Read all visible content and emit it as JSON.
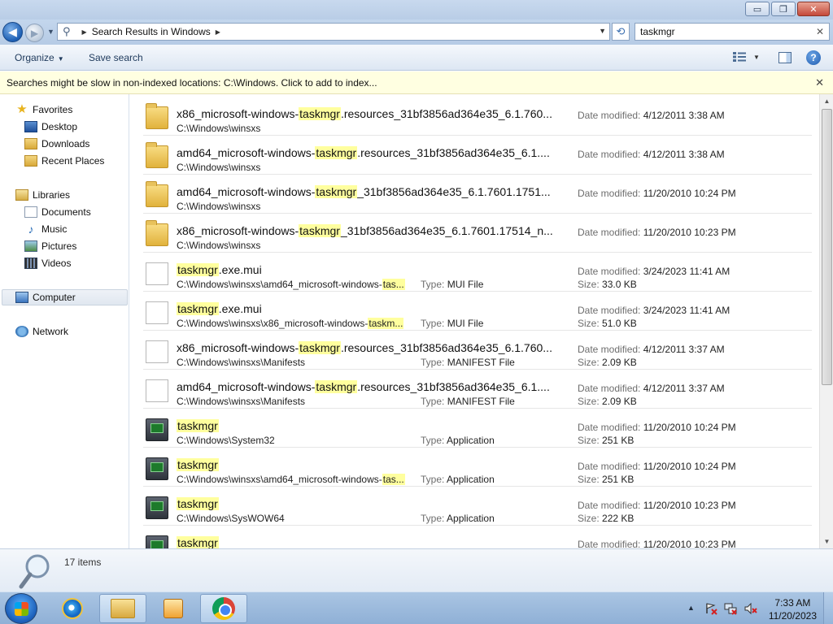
{
  "window": {
    "controls": {
      "minimize": "▭",
      "maximize": "❐",
      "close": "✕"
    }
  },
  "address_bar": {
    "breadcrumb": "Search Results in Windows",
    "search_value": "taskmgr"
  },
  "command_bar": {
    "organize": "Organize",
    "save_search": "Save search"
  },
  "info_bar": {
    "message": "Searches might be slow in non-indexed locations: C:\\Windows. Click to add to index..."
  },
  "nav_pane": {
    "favorites": "Favorites",
    "favorites_items": [
      "Desktop",
      "Downloads",
      "Recent Places"
    ],
    "libraries": "Libraries",
    "libraries_items": [
      "Documents",
      "Music",
      "Pictures",
      "Videos"
    ],
    "computer": "Computer",
    "network": "Network"
  },
  "labels": {
    "date_modified": "Date modified:",
    "size": "Size:",
    "type": "Type:"
  },
  "results": [
    {
      "icon": "folder-icon",
      "pre": "x86_microsoft-windows-",
      "hl": "taskmgr",
      "post": ".resources_31bf3856ad364e35_6.1.760...",
      "path_pre": "C:\\Windows\\winsxs",
      "path_hl": "",
      "path_post": "",
      "type": "",
      "modified": "4/12/2011 3:38 AM",
      "size": ""
    },
    {
      "icon": "folder-icon",
      "pre": "amd64_microsoft-windows-",
      "hl": "taskmgr",
      "post": ".resources_31bf3856ad364e35_6.1....",
      "path_pre": "C:\\Windows\\winsxs",
      "path_hl": "",
      "path_post": "",
      "type": "",
      "modified": "4/12/2011 3:38 AM",
      "size": ""
    },
    {
      "icon": "folder-icon",
      "pre": "amd64_microsoft-windows-",
      "hl": "taskmgr",
      "post": "_31bf3856ad364e35_6.1.7601.1751...",
      "path_pre": "C:\\Windows\\winsxs",
      "path_hl": "",
      "path_post": "",
      "type": "",
      "modified": "11/20/2010 10:24 PM",
      "size": ""
    },
    {
      "icon": "folder-icon",
      "pre": "x86_microsoft-windows-",
      "hl": "taskmgr",
      "post": "_31bf3856ad364e35_6.1.7601.17514_n...",
      "path_pre": "C:\\Windows\\winsxs",
      "path_hl": "",
      "path_post": "",
      "type": "",
      "modified": "11/20/2010 10:23 PM",
      "size": ""
    },
    {
      "icon": "file-icon",
      "pre": "",
      "hl": "taskmgr",
      "post": ".exe.mui",
      "path_pre": "C:\\Windows\\winsxs\\amd64_microsoft-windows-",
      "path_hl": "tas...",
      "path_post": "",
      "type": "MUI File",
      "modified": "3/24/2023 11:41 AM",
      "size": "33.0 KB"
    },
    {
      "icon": "file-icon",
      "pre": "",
      "hl": "taskmgr",
      "post": ".exe.mui",
      "path_pre": "C:\\Windows\\winsxs\\x86_microsoft-windows-",
      "path_hl": "taskm...",
      "path_post": "",
      "type": "MUI File",
      "modified": "3/24/2023 11:41 AM",
      "size": "51.0 KB"
    },
    {
      "icon": "file-icon",
      "pre": "x86_microsoft-windows-",
      "hl": "taskmgr",
      "post": ".resources_31bf3856ad364e35_6.1.760...",
      "path_pre": "C:\\Windows\\winsxs\\Manifests",
      "path_hl": "",
      "path_post": "",
      "type": "MANIFEST File",
      "modified": "4/12/2011 3:37 AM",
      "size": "2.09 KB"
    },
    {
      "icon": "file-icon",
      "pre": "amd64_microsoft-windows-",
      "hl": "taskmgr",
      "post": ".resources_31bf3856ad364e35_6.1....",
      "path_pre": "C:\\Windows\\winsxs\\Manifests",
      "path_hl": "",
      "path_post": "",
      "type": "MANIFEST File",
      "modified": "4/12/2011 3:37 AM",
      "size": "2.09 KB"
    },
    {
      "icon": "app-icon",
      "pre": "",
      "hl": "taskmgr",
      "post": "",
      "path_pre": "C:\\Windows\\System32",
      "path_hl": "",
      "path_post": "",
      "type": "Application",
      "modified": "11/20/2010 10:24 PM",
      "size": "251 KB"
    },
    {
      "icon": "app-icon",
      "pre": "",
      "hl": "taskmgr",
      "post": "",
      "path_pre": "C:\\Windows\\winsxs\\amd64_microsoft-windows-",
      "path_hl": "tas...",
      "path_post": "",
      "type": "Application",
      "modified": "11/20/2010 10:24 PM",
      "size": "251 KB"
    },
    {
      "icon": "app-icon",
      "pre": "",
      "hl": "taskmgr",
      "post": "",
      "path_pre": "C:\\Windows\\SysWOW64",
      "path_hl": "",
      "path_post": "",
      "type": "Application",
      "modified": "11/20/2010 10:23 PM",
      "size": "222 KB"
    },
    {
      "icon": "app-icon",
      "pre": "",
      "hl": "taskmgr",
      "post": "",
      "path_pre": "",
      "path_hl": "",
      "path_post": "",
      "type": "",
      "modified": "11/20/2010 10:23 PM",
      "size": ""
    }
  ],
  "details": {
    "count": "17 items"
  },
  "taskbar": {
    "clock_time": "7:33 AM",
    "clock_date": "11/20/2023",
    "items": [
      "internet-explorer-icon",
      "windows-explorer-icon",
      "media-center-icon",
      "chrome-icon"
    ]
  },
  "colors": {
    "highlight": "#ffff9e",
    "info_bar": "#ffffe1",
    "accent": "#1e395b"
  }
}
